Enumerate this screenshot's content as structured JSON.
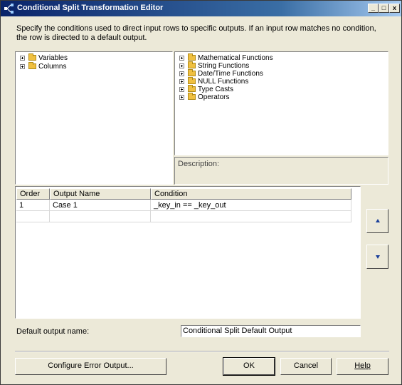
{
  "window": {
    "title": "Conditional Split Transformation Editor",
    "controls": {
      "minimize": "_",
      "maximize": "□",
      "close": "x"
    }
  },
  "description": "Specify the conditions used to direct input rows to specific outputs. If an input row matches no condition, the row is directed to a default output.",
  "left_tree": {
    "items": [
      {
        "label": "Variables"
      },
      {
        "label": "Columns"
      }
    ]
  },
  "right_tree": {
    "items": [
      {
        "label": "Mathematical Functions"
      },
      {
        "label": "String Functions"
      },
      {
        "label": "Date/Time Functions"
      },
      {
        "label": "NULL Functions"
      },
      {
        "label": "Type Casts"
      },
      {
        "label": "Operators"
      }
    ]
  },
  "description_panel": {
    "label": "Description:"
  },
  "grid": {
    "columns": [
      "Order",
      "Output Name",
      "Condition"
    ],
    "rows": [
      {
        "order": "1",
        "output_name": "Case 1",
        "condition": "_key_in == _key_out"
      },
      {
        "order": "",
        "output_name": "",
        "condition": ""
      }
    ]
  },
  "default_output": {
    "label": "Default output name:",
    "value": "Conditional Split Default Output"
  },
  "buttons": {
    "configure_error_output": "Configure Error Output...",
    "ok": "OK",
    "cancel": "Cancel",
    "help": "Help"
  },
  "colors": {
    "title_gradient_start": "#0a246a",
    "dialog_background": "#ece9d8",
    "move_arrow": "#1a3f9a"
  }
}
